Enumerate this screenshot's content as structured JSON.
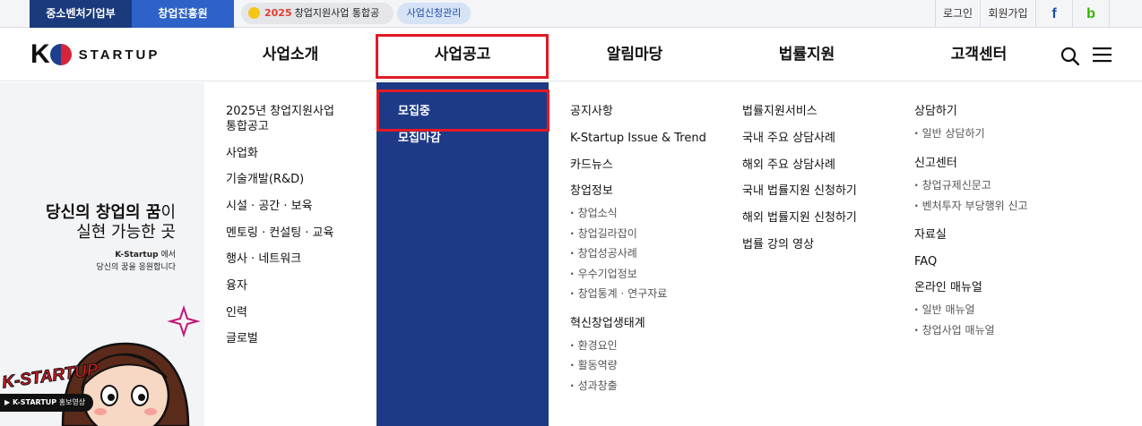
{
  "topbar": {
    "tab1": "중소벤처기업부",
    "tab2": "창업진흥원",
    "notice_year": "2025",
    "notice_text": "창업지원사업 통합공고",
    "apply_mgmt": "사업신청관리",
    "login": "로그인",
    "join": "회원가입",
    "facebook_icon": "f",
    "blog_icon": "b"
  },
  "logo": {
    "k": "K",
    "text": "STARTUP"
  },
  "menu": [
    "사업소개",
    "사업공고",
    "알림마당",
    "법률지원",
    "고객센터"
  ],
  "promo": {
    "line1_bold": "당신의 창업의 꿈",
    "line1_rest": "이",
    "line2": "실현 가능한 곳",
    "sub1_bold": "K-Startup",
    "sub1_rest": " 에서",
    "sub2": "당신의 꿈을 응원합니다",
    "mascot_text": "K-STARTUP",
    "video_bold": "▶ K-STARTUP",
    "video_rest": " 홍보영상"
  },
  "col1": [
    "2025년 창업지원사업",
    "통합공고",
    "사업화",
    "기술개발(R&D)",
    "시설 · 공간 · 보육",
    "멘토링 · 컨설팅 · 교육",
    "행사 · 네트워크",
    "융자",
    "인력",
    "글로벌"
  ],
  "col2": [
    "모집중",
    "모집마감"
  ],
  "col3": {
    "items": [
      "공지사항",
      "K-Startup Issue & Trend",
      "카드뉴스",
      "창업정보",
      "혁신창업생태계"
    ],
    "startup_info_subs": [
      "창업소식",
      "창업길라잡이",
      "창업성공사례",
      "우수기업정보",
      "창업통계 · 연구자료"
    ],
    "ecosystem_subs": [
      "환경요인",
      "활동역량",
      "성과창출"
    ]
  },
  "col4": [
    "법률지원서비스",
    "국내 주요 상담사례",
    "해외 주요 상담사례",
    "국내 법률지원 신청하기",
    "해외 법률지원 신청하기",
    "법률 강의 영상"
  ],
  "col5": {
    "consult": "상담하기",
    "consult_subs": [
      "일반 상담하기"
    ],
    "report": "신고센터",
    "report_subs": [
      "창업규제신문고",
      "벤처투자 부당행위 신고"
    ],
    "archive": "자료실",
    "faq": "FAQ",
    "manual": "온라인 매뉴얼",
    "manual_subs": [
      "일반 매뉴얼",
      "창업사업 매뉴얼"
    ]
  },
  "colors": {
    "highlight_border": "#e21a23",
    "submenu_bg": "#1e3a86",
    "tab_dark": "#1a3a7c",
    "tab_blue": "#2d63c8"
  }
}
